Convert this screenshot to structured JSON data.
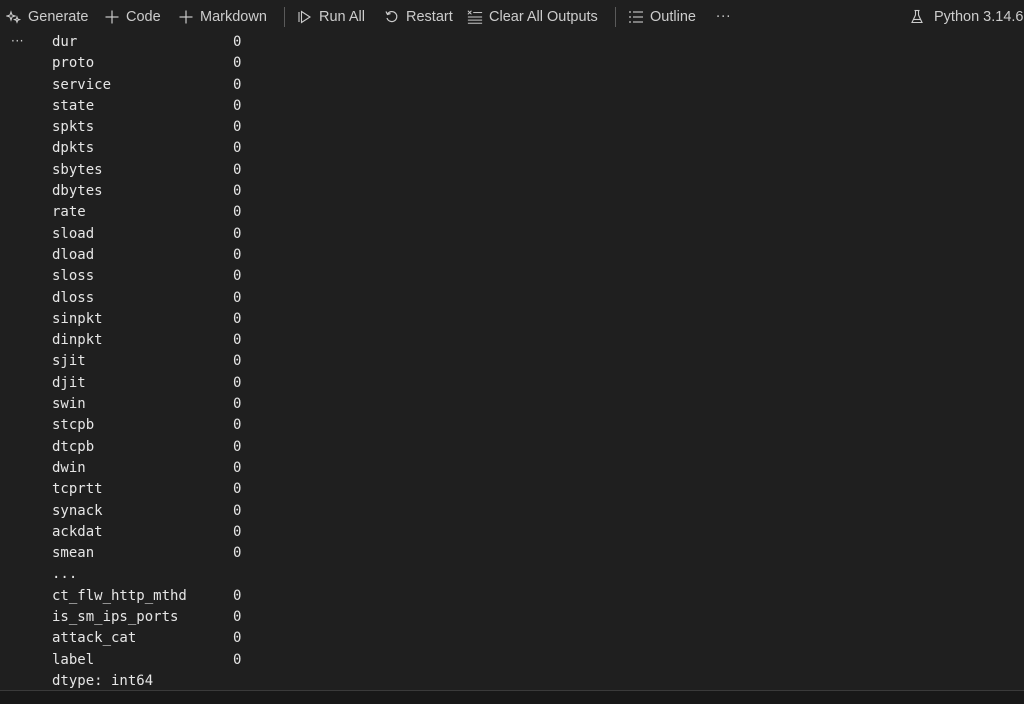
{
  "toolbar": {
    "generate": "Generate",
    "code": "Code",
    "markdown": "Markdown",
    "run_all": "Run All",
    "restart": "Restart",
    "clear_all_outputs": "Clear All Outputs",
    "outline": "Outline",
    "more": "···",
    "kernel": "Python 3.14.6"
  },
  "cell": {
    "menu": "···"
  },
  "output": {
    "rows": [
      {
        "name": "dur",
        "value": "0"
      },
      {
        "name": "proto",
        "value": "0"
      },
      {
        "name": "service",
        "value": "0"
      },
      {
        "name": "state",
        "value": "0"
      },
      {
        "name": "spkts",
        "value": "0"
      },
      {
        "name": "dpkts",
        "value": "0"
      },
      {
        "name": "sbytes",
        "value": "0"
      },
      {
        "name": "dbytes",
        "value": "0"
      },
      {
        "name": "rate",
        "value": "0"
      },
      {
        "name": "sload",
        "value": "0"
      },
      {
        "name": "dload",
        "value": "0"
      },
      {
        "name": "sloss",
        "value": "0"
      },
      {
        "name": "dloss",
        "value": "0"
      },
      {
        "name": "sinpkt",
        "value": "0"
      },
      {
        "name": "dinpkt",
        "value": "0"
      },
      {
        "name": "sjit",
        "value": "0"
      },
      {
        "name": "djit",
        "value": "0"
      },
      {
        "name": "swin",
        "value": "0"
      },
      {
        "name": "stcpb",
        "value": "0"
      },
      {
        "name": "dtcpb",
        "value": "0"
      },
      {
        "name": "dwin",
        "value": "0"
      },
      {
        "name": "tcprtt",
        "value": "0"
      },
      {
        "name": "synack",
        "value": "0"
      },
      {
        "name": "ackdat",
        "value": "0"
      },
      {
        "name": "smean",
        "value": "0"
      },
      {
        "name": "...",
        "value": ""
      },
      {
        "name": "ct_flw_http_mthd",
        "value": "0"
      },
      {
        "name": "is_sm_ips_ports",
        "value": "0"
      },
      {
        "name": "attack_cat",
        "value": "0"
      },
      {
        "name": "label",
        "value": "0"
      },
      {
        "name": "dtype: int64",
        "value": ""
      }
    ]
  },
  "colors": {
    "background": "#1f1f1f",
    "text": "#cccccc",
    "output_text": "#e6e6e6"
  },
  "icons": {
    "generate": "sparkle-icon",
    "code": "plus-icon",
    "markdown": "plus-icon",
    "run_all": "run-all-icon",
    "restart": "restart-icon",
    "clear_all_outputs": "clear-all-icon",
    "outline": "list-icon",
    "kernel": "flask-icon"
  }
}
